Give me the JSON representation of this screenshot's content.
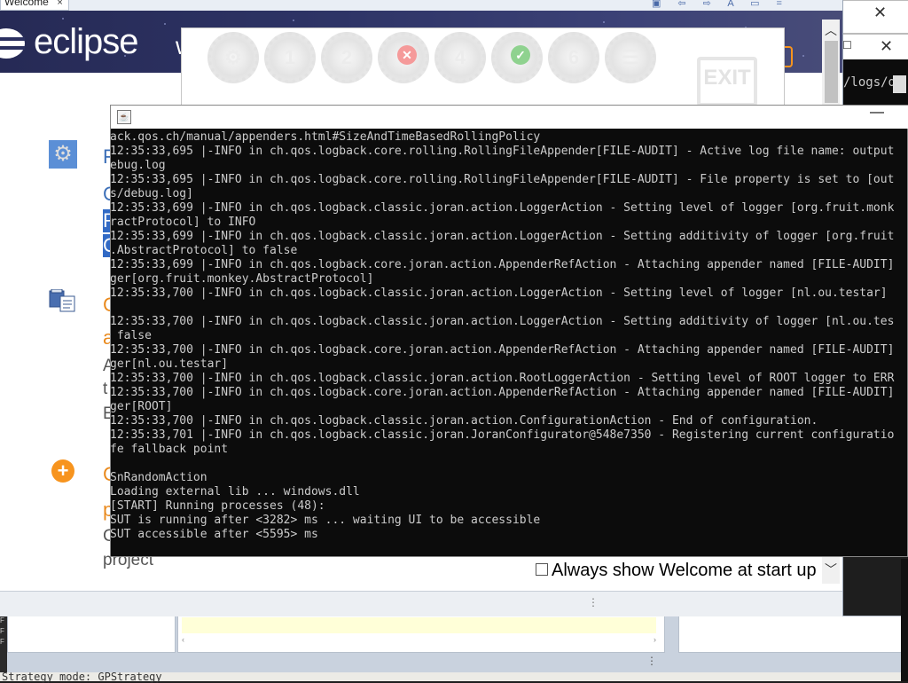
{
  "eclipse": {
    "tab_label": "Welcome",
    "tab_close": "×",
    "toolbar_glyphs": "▣ ⇦ ⇨ A ▭ =",
    "logo_text": "eclipse",
    "banner_partial": "w",
    "always_show_label": "Always show Welcome at start up",
    "items": [
      {
        "text": "F",
        "class": "blue"
      },
      {
        "text": "G",
        "class": "blue"
      },
      {
        "text": "R",
        "class": "blue-hl"
      },
      {
        "text": "G",
        "class": "blue-hl"
      },
      {
        "text": "C",
        "class": "orange"
      },
      {
        "text": "a",
        "class": "orange"
      },
      {
        "text": "A",
        "class": "grey"
      },
      {
        "text": "t",
        "class": "grey"
      },
      {
        "text": "E",
        "class": "grey"
      },
      {
        "text": "C",
        "class": "orange"
      },
      {
        "text": "p",
        "class": "orange"
      },
      {
        "text": "C",
        "class": "grey"
      },
      {
        "text": "project",
        "class": "grey"
      }
    ]
  },
  "testar_toolbar": {
    "steps": [
      "⚙",
      "1",
      "2",
      "3",
      "4",
      "5",
      "6",
      "☰"
    ],
    "exit_label": "EXIT",
    "x_mark": "✕",
    "check_mark": "✓"
  },
  "right_windows": {
    "win1_close": "✕",
    "win2_max": "☐",
    "win2_close": "✕",
    "win2_console_text": "/logs/d"
  },
  "console": {
    "title_icon": "☕",
    "minimize": "—",
    "lines": [
      "ack.qos.ch/manual/appenders.html#SizeAndTimeBasedRollingPolicy",
      "12:35:33,695 |-INFO in ch.qos.logback.core.rolling.RollingFileAppender[FILE-AUDIT] - Active log file name: output",
      "ebug.log",
      "12:35:33,695 |-INFO in ch.qos.logback.core.rolling.RollingFileAppender[FILE-AUDIT] - File property is set to [out",
      "s/debug.log]",
      "12:35:33,699 |-INFO in ch.qos.logback.classic.joran.action.LoggerAction - Setting level of logger [org.fruit.monk",
      "ractProtocol] to INFO",
      "12:35:33,699 |-INFO in ch.qos.logback.classic.joran.action.LoggerAction - Setting additivity of logger [org.fruit",
      ".AbstractProtocol] to false",
      "12:35:33,699 |-INFO in ch.qos.logback.core.joran.action.AppenderRefAction - Attaching appender named [FILE-AUDIT]",
      "ger[org.fruit.monkey.AbstractProtocol]",
      "12:35:33,700 |-INFO in ch.qos.logback.classic.joran.action.LoggerAction - Setting level of logger [nl.ou.testar]",
      "",
      "12:35:33,700 |-INFO in ch.qos.logback.classic.joran.action.LoggerAction - Setting additivity of logger [nl.ou.tes",
      " false",
      "12:35:33,700 |-INFO in ch.qos.logback.core.joran.action.AppenderRefAction - Attaching appender named [FILE-AUDIT]",
      "ger[nl.ou.testar]",
      "12:35:33,700 |-INFO in ch.qos.logback.classic.joran.action.RootLoggerAction - Setting level of ROOT logger to ERR",
      "12:35:33,700 |-INFO in ch.qos.logback.core.joran.action.AppenderRefAction - Attaching appender named [FILE-AUDIT]",
      "ger[ROOT]",
      "12:35:33,700 |-INFO in ch.qos.logback.classic.joran.action.ConfigurationAction - End of configuration.",
      "12:35:33,701 |-INFO in ch.qos.logback.classic.joran.JoranConfigurator@548e7350 - Registering current configuratio",
      "fe fallback point",
      "",
      "SnRandomAction",
      "Loading external lib ... windows.dll",
      "[START] Running processes (48):",
      "SUT is running after <3282> ms ... waiting UI to be accessible",
      "SUT accessible after <5595> ms"
    ]
  },
  "background": {
    "status_text": "Strategy mode: GPStrategy",
    "left_strip_text": "F\nF\nF"
  }
}
